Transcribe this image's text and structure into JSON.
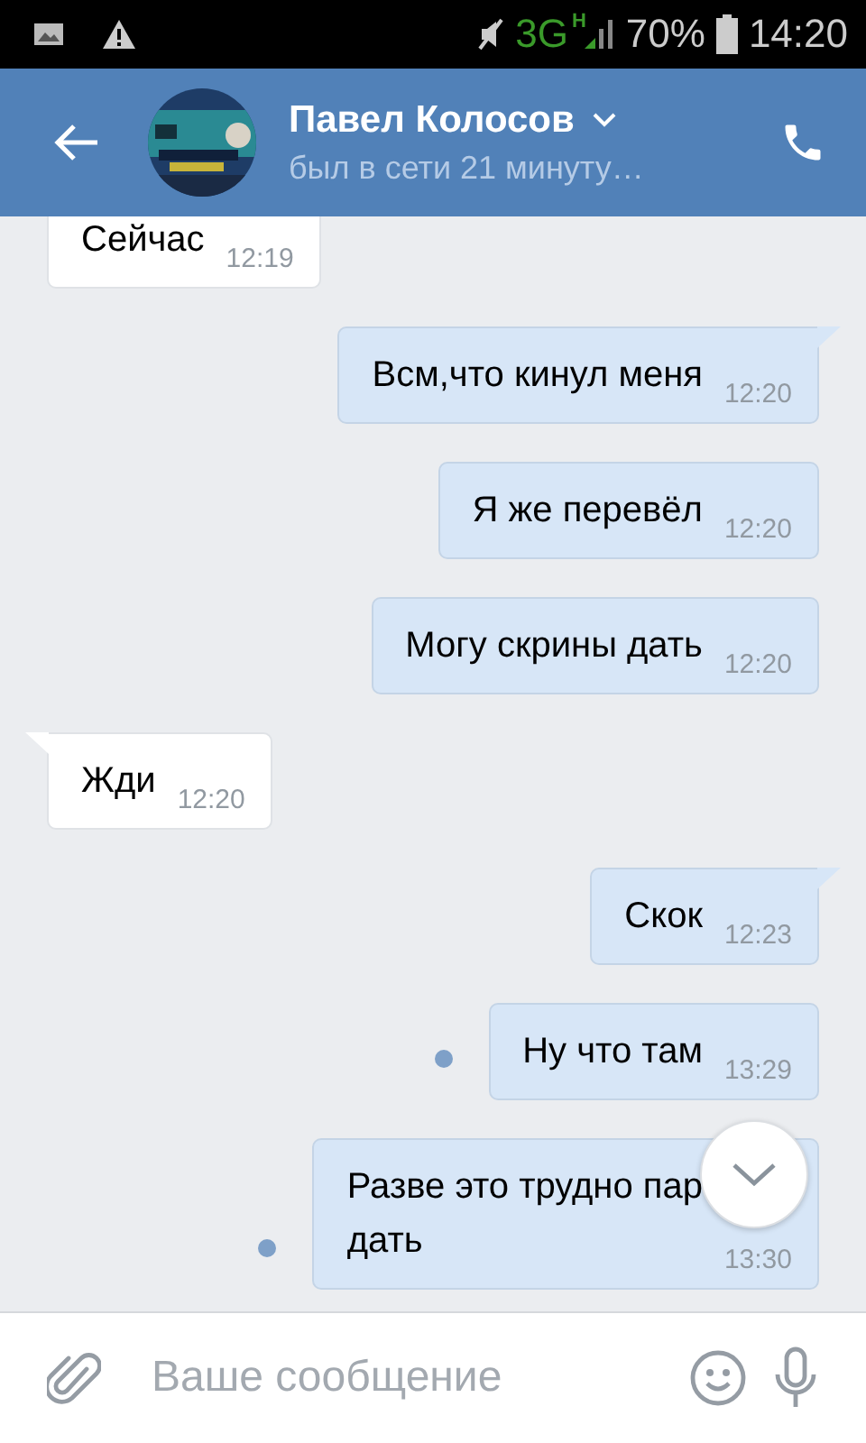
{
  "status_bar": {
    "network": "3G",
    "network_sub": "H",
    "battery": "70%",
    "time": "14:20"
  },
  "header": {
    "name": "Павел Колосов",
    "status": "был в сети 21 минуту…"
  },
  "messages": [
    {
      "kind": "incoming",
      "text": "Сейчас",
      "time": "12:19",
      "tail": false,
      "unread": false
    },
    {
      "kind": "outgoing",
      "text": "Всм,что кинул меня",
      "time": "12:20",
      "tail": true,
      "unread": false
    },
    {
      "kind": "outgoing",
      "text": "Я же перевёл",
      "time": "12:20",
      "tail": false,
      "unread": false
    },
    {
      "kind": "outgoing",
      "text": "Могу скрины дать",
      "time": "12:20",
      "tail": false,
      "unread": false
    },
    {
      "kind": "incoming",
      "text": "Жди",
      "time": "12:20",
      "tail": true,
      "unread": false
    },
    {
      "kind": "outgoing",
      "text": "Скок",
      "time": "12:23",
      "tail": true,
      "unread": false
    },
    {
      "kind": "outgoing",
      "text": "Ну что там",
      "time": "13:29",
      "tail": false,
      "unread": true
    },
    {
      "kind": "outgoing",
      "text": "Разве это трудно пар\nдать",
      "time": "13:30",
      "tail": false,
      "unread": true
    }
  ],
  "composer": {
    "placeholder": "Ваше сообщение"
  }
}
